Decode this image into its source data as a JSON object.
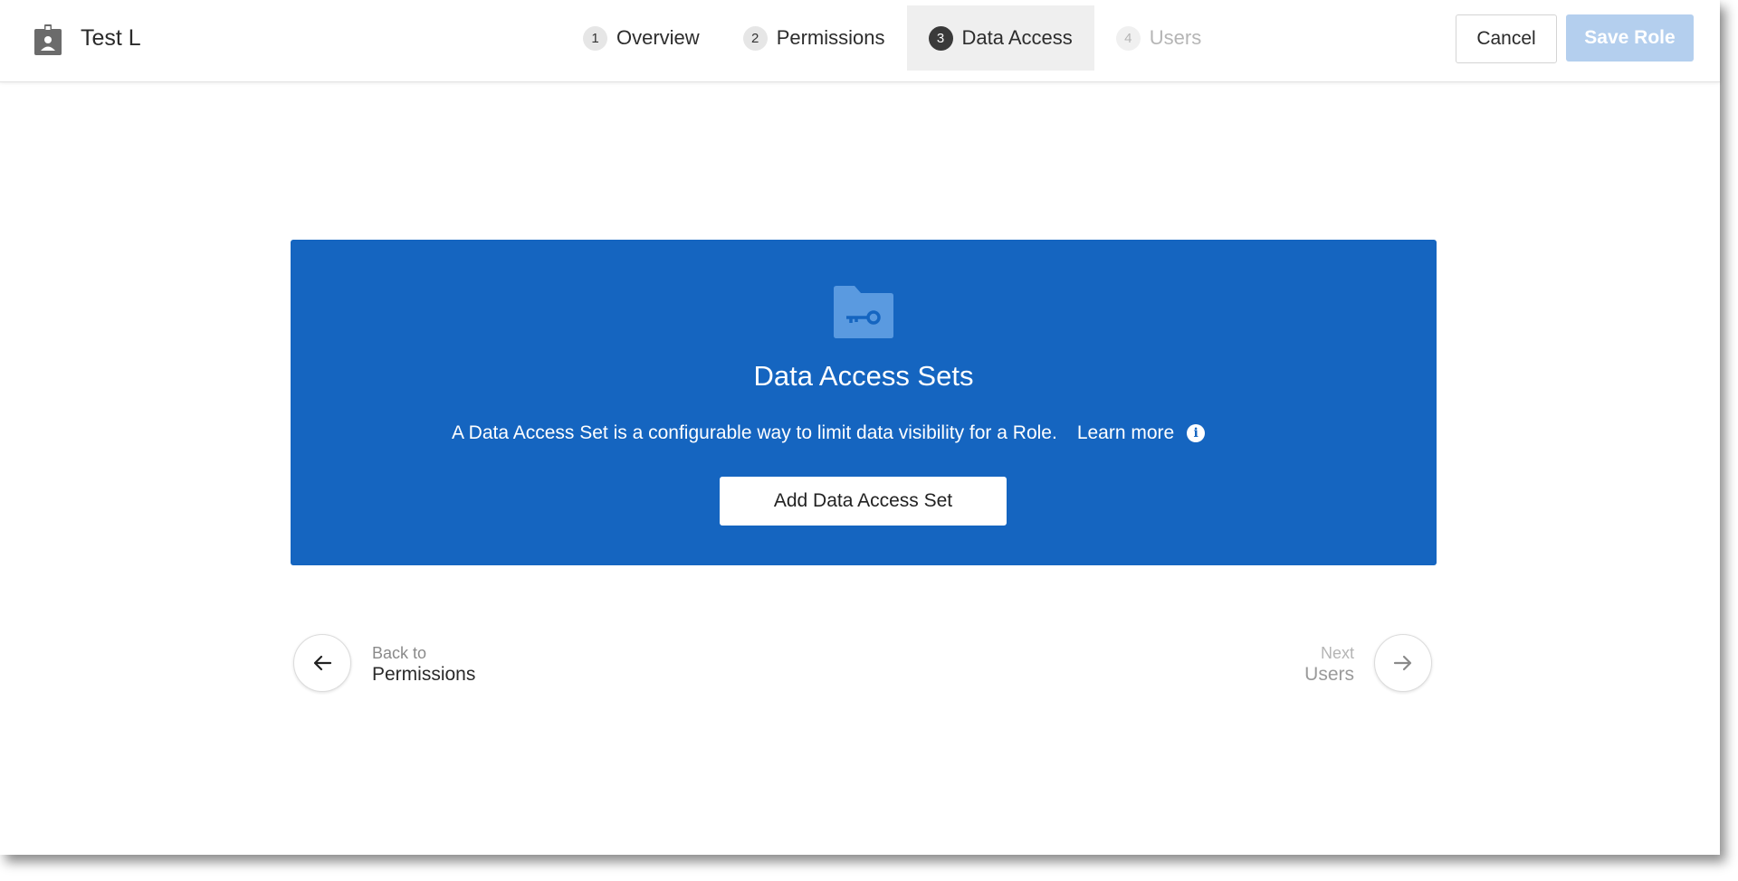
{
  "header": {
    "role_name": "Test L",
    "steps": [
      {
        "number": "1",
        "label": "Overview",
        "state": "complete"
      },
      {
        "number": "2",
        "label": "Permissions",
        "state": "complete"
      },
      {
        "number": "3",
        "label": "Data Access",
        "state": "active"
      },
      {
        "number": "4",
        "label": "Users",
        "state": "disabled"
      }
    ],
    "cancel_label": "Cancel",
    "save_label": "Save Role"
  },
  "banner": {
    "title": "Data Access Sets",
    "description": "A Data Access Set is a configurable way to limit data visibility for a Role.",
    "learn_more": "Learn more",
    "info_glyph": "i",
    "add_button_label": "Add Data Access Set",
    "icon": "folder-key-icon",
    "background_color": "#1565c0"
  },
  "nav": {
    "back_caption": "Back to",
    "back_target": "Permissions",
    "next_caption": "Next",
    "next_target": "Users"
  }
}
